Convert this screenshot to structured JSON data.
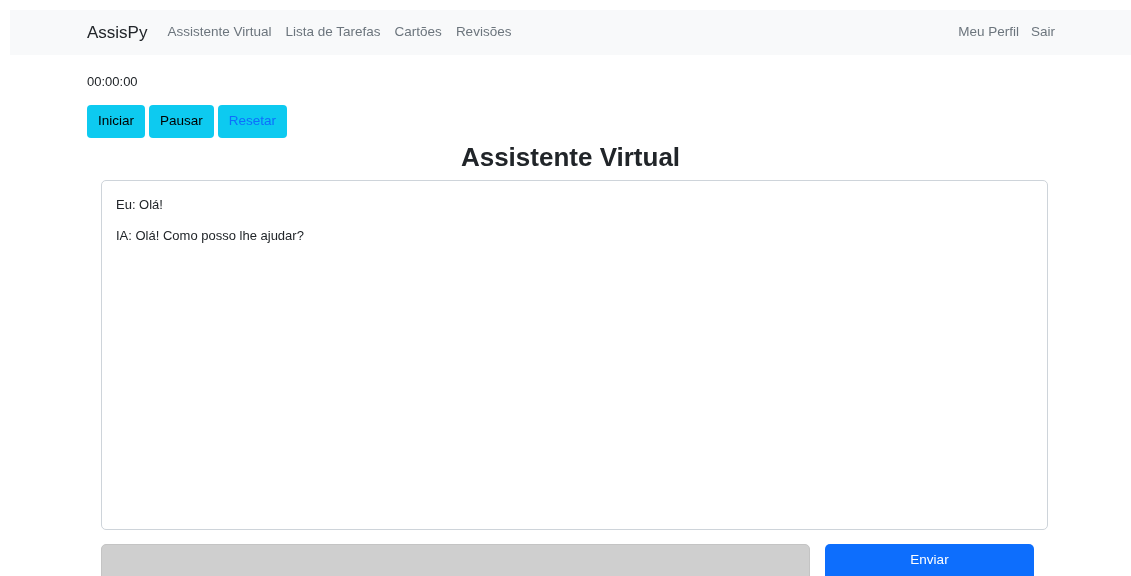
{
  "navbar": {
    "brand": "AssisPy",
    "links": [
      "Assistente Virtual",
      "Lista de Tarefas",
      "Cartões",
      "Revisões"
    ],
    "right_links": [
      "Meu Perfil",
      "Sair"
    ]
  },
  "timer": {
    "display": "00:00:00",
    "buttons": [
      {
        "label": "Iniciar",
        "kind": "dark"
      },
      {
        "label": "Pausar",
        "kind": "dark"
      },
      {
        "label": "Resetar",
        "kind": "link"
      }
    ]
  },
  "title": "Assistente Virtual",
  "chat": {
    "messages": [
      "Eu: Olá!",
      "IA: Olá! Como posso lhe ajudar?"
    ]
  },
  "send_button": "Enviar"
}
